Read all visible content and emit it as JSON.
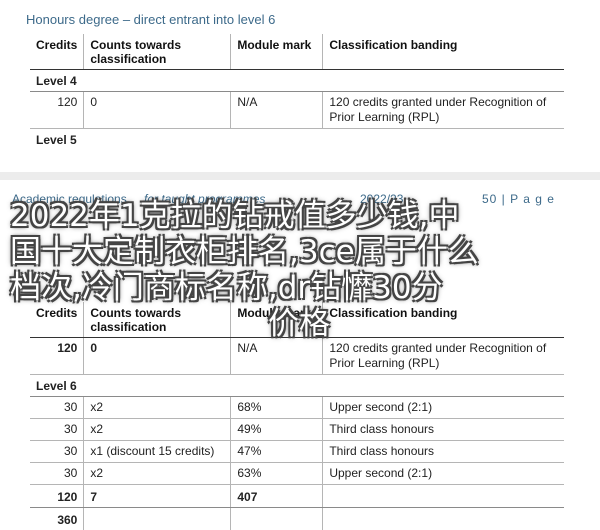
{
  "top": {
    "heading": "Honours degree – direct entrant into level 6",
    "headers": [
      "Credits",
      "Counts towards classification",
      "Module mark",
      "Classification banding"
    ],
    "level4_label": "Level 4",
    "level4_row": {
      "credits": "120",
      "counts": "0",
      "mark": "N/A",
      "banding": "120 credits granted under Recognition of Prior Learning (RPL)"
    },
    "level5_label": "Level 5"
  },
  "footer": {
    "left": "Academic regulations",
    "middle": "for taught programmes",
    "year": "2022/23",
    "page": "50 | P a g e"
  },
  "overlay": {
    "line1": "2022年1克拉的钻戒值多少钱,中",
    "line2": "国十大定制衣柜排名,3ce属于什么",
    "line3": "档次,冷门商标名称,dr钻戂30分",
    "line4": "价格"
  },
  "bottom": {
    "headers": [
      "Credits",
      "Counts towards classification",
      "Module mark",
      "Classification banding"
    ],
    "rpl_row": {
      "credits": "120",
      "counts": "0",
      "mark": "N/A",
      "banding": "120 credits granted under Recognition of Prior Learning (RPL)"
    },
    "level6_label": "Level 6",
    "rows": [
      {
        "credits": "30",
        "counts": "x2",
        "mark": "68%",
        "banding": "Upper second (2:1)"
      },
      {
        "credits": "30",
        "counts": "x2",
        "mark": "49%",
        "banding": "Third class honours"
      },
      {
        "credits": "30",
        "counts": "x1 (discount 15 credits)",
        "mark": "47%",
        "banding": "Third class honours"
      },
      {
        "credits": "30",
        "counts": "x2",
        "mark": "63%",
        "banding": "Upper second (2:1)"
      }
    ],
    "total_row": {
      "credits": "120",
      "counts": "7",
      "mark": "407"
    },
    "grand_total": "360"
  }
}
